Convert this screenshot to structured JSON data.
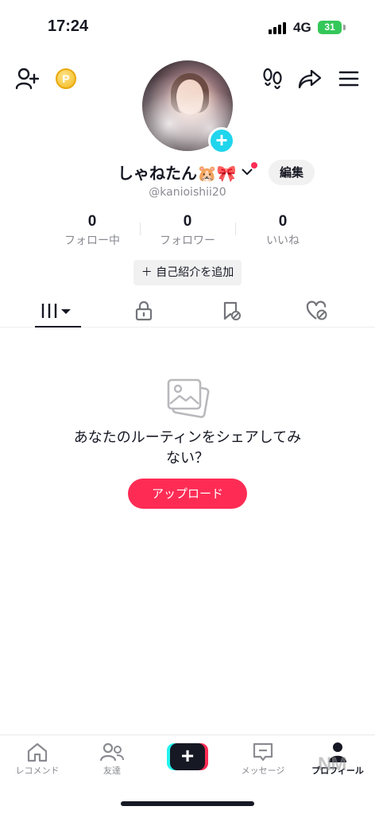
{
  "status_bar": {
    "time": "17:24",
    "network": "4G",
    "battery": "31"
  },
  "header": {
    "coin_symbol": "P"
  },
  "profile": {
    "display_name": "しゃねたん🐹🎀",
    "username": "@kanioishii20",
    "edit_label": "編集",
    "bio_button": "＋ 自己紹介を追加"
  },
  "stats": [
    {
      "value": "0",
      "label": "フォロー中"
    },
    {
      "value": "0",
      "label": "フォロワー"
    },
    {
      "value": "0",
      "label": "いいね"
    }
  ],
  "empty_state": {
    "title": "あなたのルーティンをシェアしてみない？",
    "upload_label": "アップロード"
  },
  "bottom_nav": {
    "home": "レコメンド",
    "friends": "友達",
    "inbox": "メッセージ",
    "profile": "プロフィール"
  },
  "watermark": "NM",
  "colors": {
    "accent": "#fe2c55",
    "cyan": "#20d5ec",
    "battery": "#34c759"
  }
}
